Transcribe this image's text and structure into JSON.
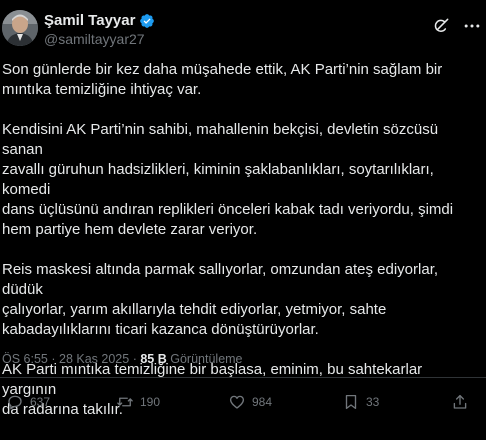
{
  "author": {
    "display_name": "Şamil Tayyar",
    "handle": "@samiltayyar27"
  },
  "tweet": {
    "paragraphs": [
      "Son günlerde bir kez daha müşahede ettik, AK Parti’nin sağlam bir\nmıntıka temizliğine ihtiyaç var.",
      "Kendisini AK Parti’nin sahibi, mahallenin bekçisi, devletin sözcüsü sanan\nzavallı güruhun hadsizlikleri, kiminin şaklabanlıkları, soytarılıkları, komedi\ndans üçlüsünü andıran replikleri önceleri kabak tadı veriyordu, şimdi\nhem partiye hem devlete zarar veriyor.",
      "Reis maskesi altında parmak sallıyorlar, omzundan ateş ediyorlar, düdük\nçalıyorlar, yarım akıllarıyla tehdit ediyorlar, yetmiyor, sahte\nkabadayılıklarını ticari kazanca dönüştürüyorlar.",
      "AK Parti mıntıka temizliğine bir başlasa, eminim, bu sahtekarlar yargının\nda radarına takılır."
    ]
  },
  "meta": {
    "time": "ÖS 6:55",
    "separator": "·",
    "date": "28 Kas 2025",
    "views_count": "85 B",
    "views_label": "Görüntüleme"
  },
  "actions": {
    "replies": "637",
    "reposts": "190",
    "likes": "984",
    "bookmarks": "33"
  },
  "colors": {
    "background": "#000000",
    "text": "#e7e9ea",
    "secondary": "#71767b",
    "verified": "#1d9bf0",
    "divider": "#2f3336"
  },
  "icons": [
    "verified-badge-icon",
    "grok-icon",
    "more-icon",
    "reply-icon",
    "repost-icon",
    "like-icon",
    "bookmark-icon",
    "share-icon"
  ]
}
